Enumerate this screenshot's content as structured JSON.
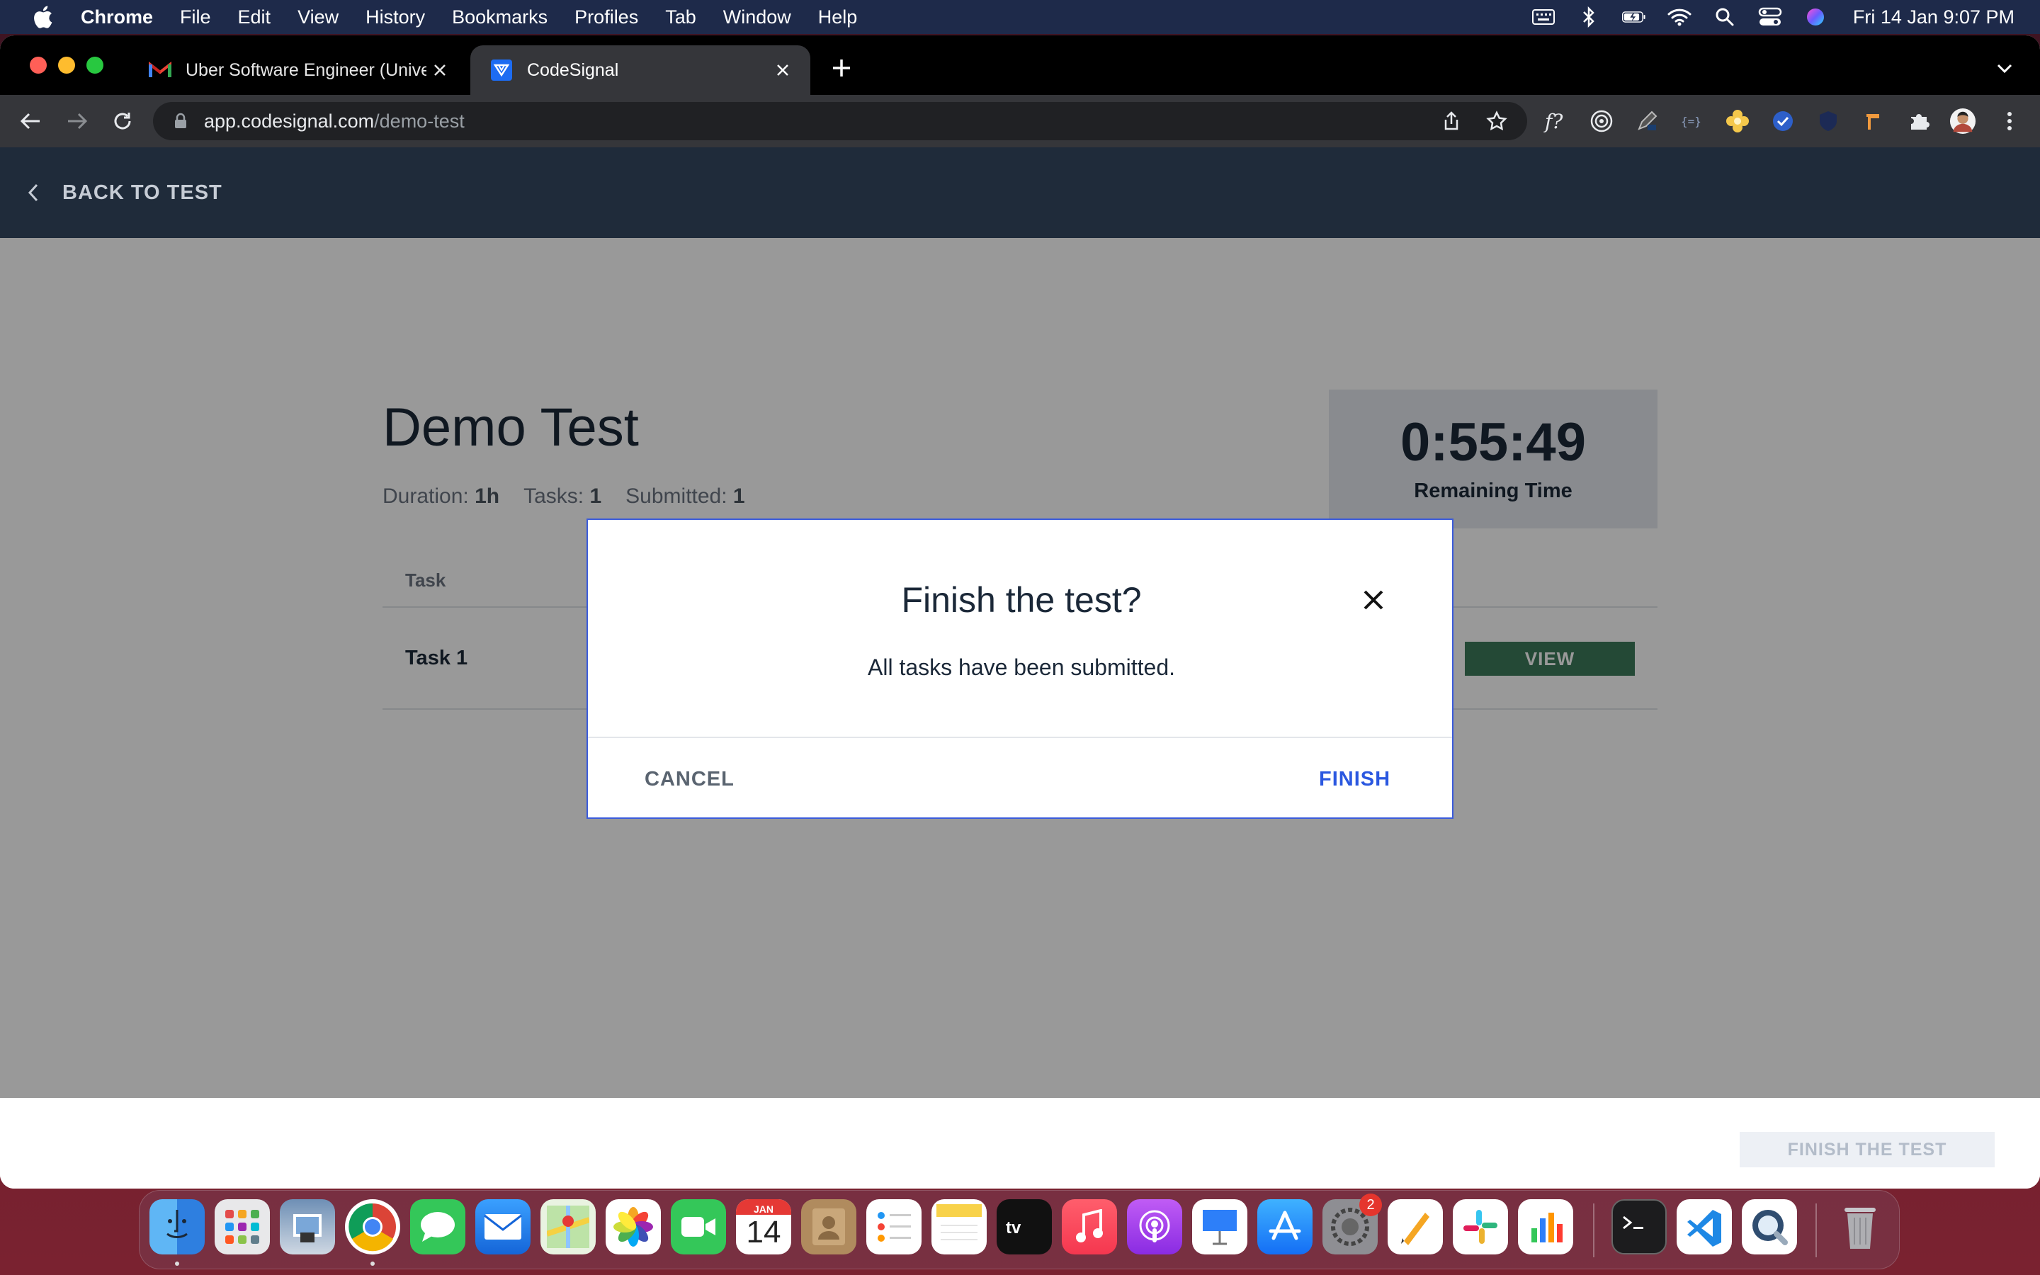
{
  "menubar": {
    "app": "Chrome",
    "items": [
      "File",
      "Edit",
      "View",
      "History",
      "Bookmarks",
      "Profiles",
      "Tab",
      "Window",
      "Help"
    ],
    "clock": "Fri 14 Jan  9:07 PM",
    "status_icons": [
      "keyboard-icon",
      "bluetooth-icon",
      "battery-icon",
      "wifi-icon",
      "spotlight-icon",
      "control-center-icon",
      "siri-icon"
    ]
  },
  "browser": {
    "tabs": [
      {
        "title": "Uber Software Engineer (Unive",
        "favicon": "gmail-icon"
      },
      {
        "title": "CodeSignal",
        "favicon": "codesignal-icon"
      }
    ],
    "url_host": "app.codesignal.com",
    "url_path": "/demo-test"
  },
  "page": {
    "back_label": "BACK TO TEST",
    "title": "Demo Test",
    "meta": {
      "duration_label": "Duration:",
      "duration_value": "1h",
      "tasks_label": "Tasks:",
      "tasks_value": "1",
      "submitted_label": "Submitted:",
      "submitted_value": "1"
    },
    "timer": {
      "time": "0:55:49",
      "label": "Remaining Time"
    },
    "table": {
      "header": "Task",
      "rows": [
        {
          "name": "Task 1",
          "action": "VIEW"
        }
      ]
    },
    "footer_button": "FINISH THE TEST"
  },
  "modal": {
    "title": "Finish the test?",
    "message": "All tasks have been submitted.",
    "cancel": "CANCEL",
    "finish": "FINISH"
  },
  "dock": {
    "calendar_month": "JAN",
    "calendar_day": "14",
    "settings_badge": "2"
  },
  "colors": {
    "header_bg": "#1f2b3a",
    "view_button": "#3d7a5a",
    "finish_link": "#2b58e0",
    "modal_border": "#3b5bdb"
  }
}
